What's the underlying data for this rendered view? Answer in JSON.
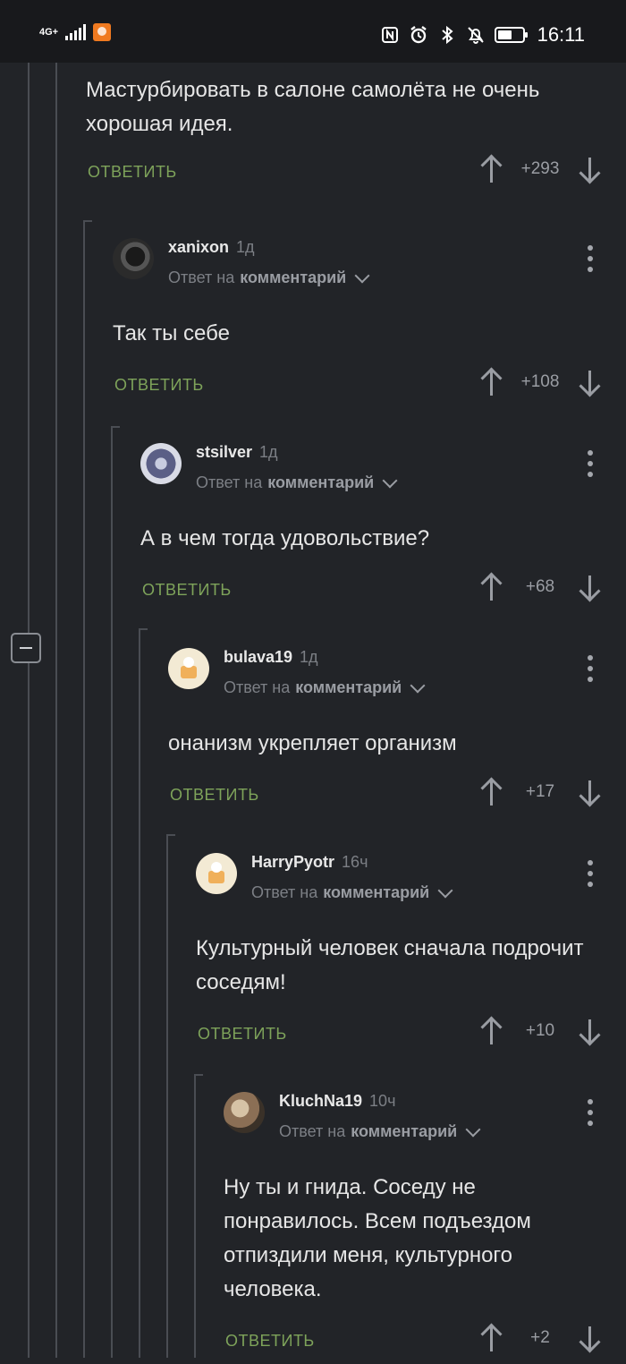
{
  "status_bar": {
    "network": "4G+",
    "time": "16:11",
    "battery_level": 0.6,
    "icons": [
      "nfc-icon",
      "alarm-icon",
      "bluetooth-icon",
      "mute-icon"
    ]
  },
  "colors": {
    "background": "#222428",
    "accent_reply": "#7ea35a",
    "muted": "#7c7f85"
  },
  "comments": [
    {
      "text": "Мастурбировать в салоне самолёта не очень хорошая идея.",
      "reply_label": "ОТВЕТИТЬ",
      "score": "+293"
    },
    {
      "author": "xanixon",
      "time": "1д",
      "reply_prefix": "Ответ на",
      "reply_target": "комментарий",
      "text": "Так ты себе",
      "reply_label": "ОТВЕТИТЬ",
      "score": "+108"
    },
    {
      "author": "stsilver",
      "time": "1д",
      "reply_prefix": "Ответ на",
      "reply_target": "комментарий",
      "text": "А в чем тогда удовольствие?",
      "reply_label": "ОТВЕТИТЬ",
      "score": "+68"
    },
    {
      "author": "bulava19",
      "time": "1д",
      "reply_prefix": "Ответ на",
      "reply_target": "комментарий",
      "text": "онанизм укрепляет организм",
      "reply_label": "ОТВЕТИТЬ",
      "score": "+17"
    },
    {
      "author": "HarryPyotr",
      "time": "16ч",
      "reply_prefix": "Ответ на",
      "reply_target": "комментарий",
      "text": "Культурный человек сначала подрочит соседям!",
      "reply_label": "ОТВЕТИТЬ",
      "score": "+10"
    },
    {
      "author": "KluchNa19",
      "time": "10ч",
      "reply_prefix": "Ответ на",
      "reply_target": "комментарий",
      "text": "Ну ты и гнида. Соседу не понравилось. Всем подъездом отпиздили меня, культурного человека.",
      "reply_label": "ОТВЕТИТЬ",
      "score": "+2"
    }
  ]
}
